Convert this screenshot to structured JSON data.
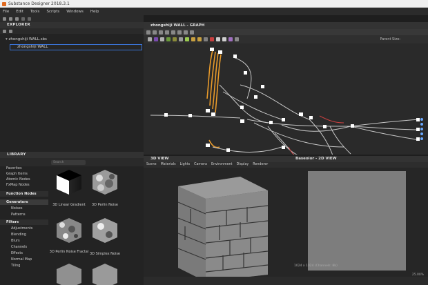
{
  "window": {
    "title": "Substance Designer 2018.3.1"
  },
  "menu": [
    "File",
    "Edit",
    "Tools",
    "Scripts",
    "Windows",
    "Help"
  ],
  "explorer": {
    "header": "EXPLORER",
    "package": "zhongshiji WALL.sbs",
    "graph": "zhongshiji WALL"
  },
  "graph": {
    "header": "zhongshiji WALL - GRAPH",
    "parent_size_label": "Parent Size:"
  },
  "library": {
    "header": "LIBRARY",
    "search_placeholder": "Search",
    "categories": [
      {
        "label": "Favorites",
        "kind": "item"
      },
      {
        "label": "Graph Items",
        "kind": "item"
      },
      {
        "label": "Atomic Nodes",
        "kind": "item"
      },
      {
        "label": "FxMap Nodes",
        "kind": "item"
      },
      {
        "label": "Function Nodes",
        "kind": "head"
      },
      {
        "label": "Generators",
        "kind": "head-selected"
      },
      {
        "label": "Noises",
        "kind": "sub"
      },
      {
        "label": "Patterns",
        "kind": "sub"
      },
      {
        "label": "Filters",
        "kind": "head"
      },
      {
        "label": "Adjustments",
        "kind": "sub"
      },
      {
        "label": "Blending",
        "kind": "sub"
      },
      {
        "label": "Blurs",
        "kind": "sub"
      },
      {
        "label": "Channels",
        "kind": "sub"
      },
      {
        "label": "Effects",
        "kind": "sub"
      },
      {
        "label": "Normal Map",
        "kind": "sub"
      },
      {
        "label": "Tiling",
        "kind": "sub"
      }
    ],
    "items": [
      "3D Linear Gradient",
      "3D Perlin Noise",
      "3D Perlin Noise Fractal",
      "3D Simplex Noise"
    ]
  },
  "view3d": {
    "header": "3D VIEW",
    "menu": [
      "Scene",
      "Materials",
      "Lights",
      "Camera",
      "Environment",
      "Display",
      "Renderer"
    ]
  },
  "view2d": {
    "header": "Baseolor - 2D VIEW",
    "resolution": "1024 x 1024 (Channels: 8b)",
    "zoom": "25.00%"
  }
}
